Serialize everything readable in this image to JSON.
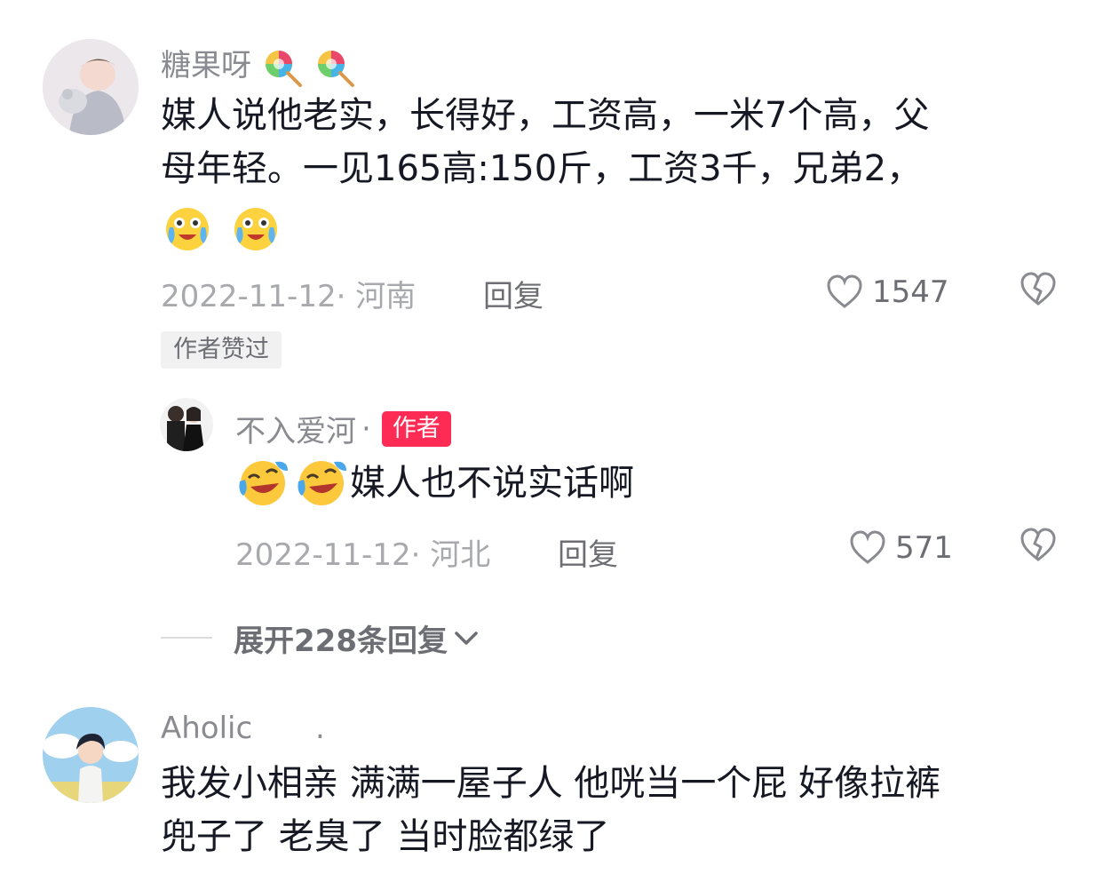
{
  "comments": [
    {
      "username": "糖果呀",
      "username_emojis": [
        "lollipop-icon",
        "lollipop-icon"
      ],
      "text_lines": [
        "媒人说他老实，长得好，工资高，一米7个高，父",
        "母年轻。一见165高:150斤，工资3千，兄弟2，"
      ],
      "text_emojis": [
        "tears-of-joy-icon",
        "tears-of-joy-icon"
      ],
      "date": "2022-11-12",
      "location": "河南",
      "reply_label": "回复",
      "likes": "1547",
      "badge": "作者赞过",
      "reply": {
        "username": "不入爱河",
        "author_tag": "作者",
        "text_emojis": [
          "rolling-laugh-icon",
          "rolling-laugh-icon"
        ],
        "text": "媒人也不说实话啊",
        "date": "2022-11-12",
        "location": "河北",
        "reply_label": "回复",
        "likes": "571"
      },
      "expand_label": "展开228条回复"
    },
    {
      "username": "Aholic",
      "text_lines": [
        "我发小相亲 满满一屋子人 他咣当一个屁 好像拉裤",
        "兜子了 老臭了 当时脸都绿了"
      ]
    }
  ],
  "colors": {
    "text": "#161823",
    "secondary": "#8a8b91",
    "accent": "#fe2c55",
    "muted_bg": "#f1f1f2"
  }
}
